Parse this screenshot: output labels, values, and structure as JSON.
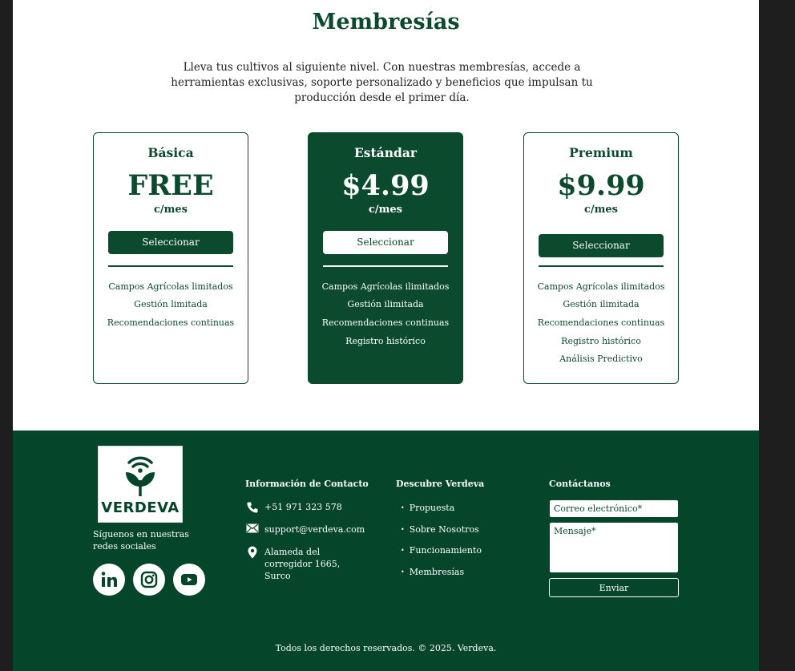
{
  "membership": {
    "title": "Membresías",
    "intro": "Lleva tus cultivos al siguiente nivel. Con nuestras membresías, accede a herramientas exclusivas, soporte personalizado y beneficios que impulsan tu producción desde el primer día.",
    "plans": [
      {
        "name": "Básica",
        "price": "FREE",
        "period": "c/mes",
        "button": "Seleccionar",
        "features": [
          "Campos Agrícolas limitados",
          "Gestión limitada",
          "Recomendaciones continuas"
        ]
      },
      {
        "name": "Estándar",
        "price": "$4.99",
        "period": "c/mes",
        "button": "Seleccionar",
        "features": [
          "Campos Agrícolas ilimitados",
          "Gestión ilimitada",
          "Recomendaciones continuas",
          "Registro histórico"
        ]
      },
      {
        "name": "Premium",
        "price": "$9.99",
        "period": "c/mes",
        "button": "Seleccionar",
        "features": [
          "Campos Agrícolas ilimitados",
          "Gestión ilimitada",
          "Recomendaciones continuas",
          "Registro histórico",
          "Análisis Predictivo"
        ]
      }
    ]
  },
  "footer": {
    "logo_text": "VERDEVA",
    "follow_text": "Síguenos en nuestras redes sociales",
    "social_icons": [
      "linkedin-icon",
      "instagram-icon",
      "youtube-icon"
    ],
    "contact": {
      "title": "Información de Contacto",
      "phone": "+51 971 323 578",
      "email": "support@verdeva.com",
      "address": "Alameda del corregidor 1665, Surco"
    },
    "discover": {
      "title": "Descubre Verdeva",
      "items": [
        "Propuesta",
        "Sobre Nosotros",
        "Funcionamiento",
        "Membresías"
      ]
    },
    "form": {
      "title": "Contáctanos",
      "email_placeholder": "Correo electrónico*",
      "message_placeholder": "Mensaje*",
      "send_label": "Enviar"
    },
    "copyright": "Todos los derechos reservados. © 2025. Verdeva."
  },
  "colors": {
    "brand": "#0b4a2c",
    "footer_bg": "#05452a",
    "frame": "#1e1e1e"
  }
}
